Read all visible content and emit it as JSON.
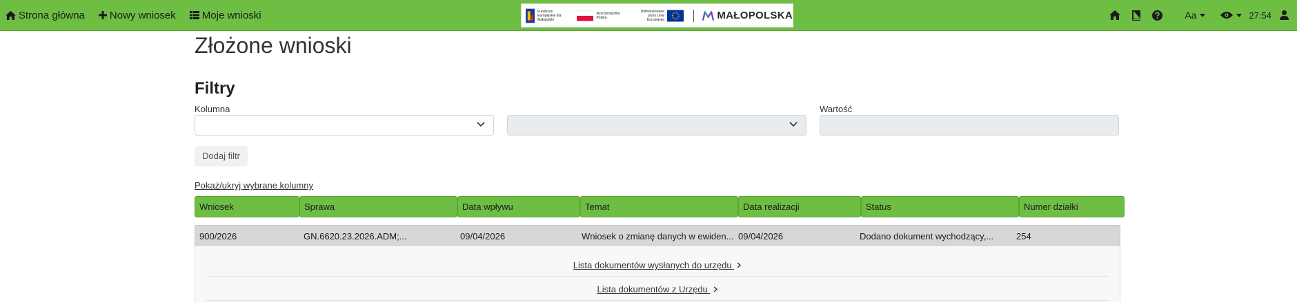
{
  "nav": {
    "home_label": "Strona główna",
    "new_label": "Nowy wniosek",
    "my_label": "Moje wnioski",
    "font_size_label": "Aa",
    "timer": "27:54"
  },
  "logos": {
    "fundusze": "Fundusze Europejskie dla Małopolski",
    "rzeczpospolita": "Rzeczpospolita Polska",
    "ue": "Dofinansowane przez Unię Europejską",
    "malopolska": "MAŁOPOLSKA"
  },
  "page": {
    "title": "Złożone wnioski",
    "filters_title": "Filtry",
    "column_label": "Kolumna",
    "value_label": "Wartość",
    "add_filter": "Dodaj filtr",
    "toggle_columns": "Pokaż/ukryj wybrane kolumny"
  },
  "table": {
    "headers": [
      "Wniosek",
      "Sprawa",
      "Data wpływu",
      "Temat",
      "Data realizacji",
      "Status",
      "Numer działki"
    ],
    "row": [
      "900/2026",
      "GN.6620.23.2026.ADM;...",
      "09/04/2026",
      "Wniosek o zmianę danych w ewiden...",
      "09/04/2026",
      "Dodano dokument wychodzący,...",
      "254"
    ]
  },
  "details": {
    "sent_docs": "Lista dokumentów wysłanych do urzędu",
    "office_docs": "Lista dokumentów z Urzędu"
  },
  "colors": {
    "accent": "#6fbe44",
    "row_bg": "#d6d7d8"
  }
}
